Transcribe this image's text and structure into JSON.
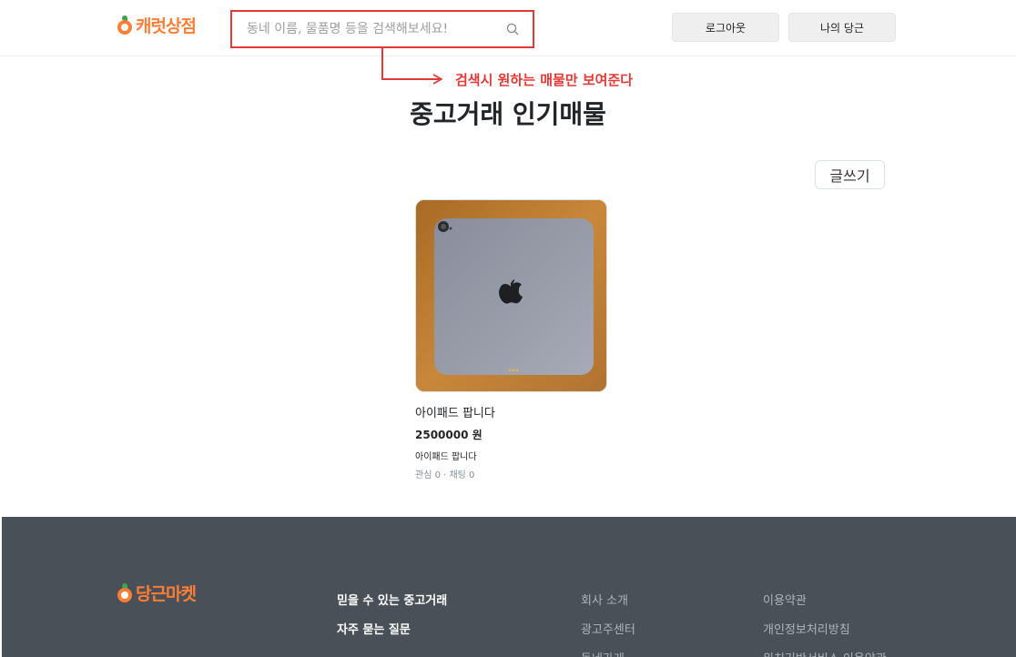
{
  "header": {
    "logo_text": "캐럿상점",
    "search": {
      "placeholder": "동네 이름, 물품명 등을 검색해보세요!",
      "value": ""
    },
    "logout_label": "로그아웃",
    "my_label": "나의 당근"
  },
  "annotation": {
    "text": "검색시 원하는 매물만 보여준다"
  },
  "main": {
    "title": "중고거래 인기매물",
    "write_label": "글쓰기",
    "items": [
      {
        "title": "아이패드 팝니다",
        "price": "2500000 원",
        "description": "아이패드 팝니다",
        "meta": "관심 0 · 채팅 0"
      }
    ]
  },
  "footer": {
    "logo_text": "당근마켓",
    "col1": [
      "믿을 수 있는 중고거래",
      "자주 묻는 질문"
    ],
    "col2": [
      "회사 소개",
      "광고주센터",
      "동네가게"
    ],
    "col3": [
      "이용약관",
      "개인정보처리방침",
      "위치기반서비스 이용약관"
    ]
  },
  "colors": {
    "brand": "#ff7e36",
    "annotation": "#e53935",
    "footer_bg": "#495057"
  }
}
